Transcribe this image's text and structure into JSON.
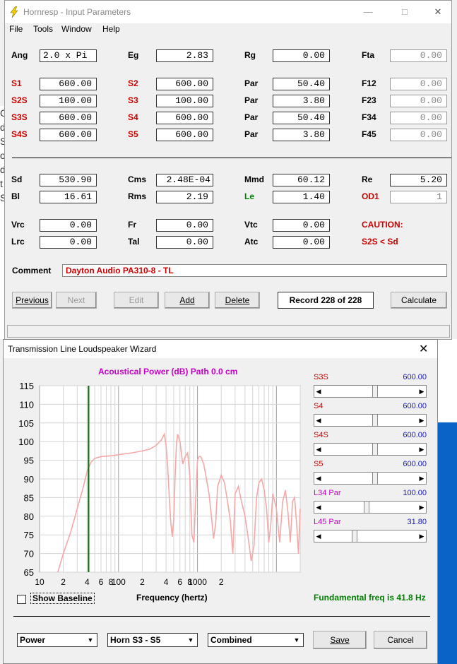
{
  "main_window": {
    "title": "Hornresp - Input Parameters",
    "menu": [
      "File",
      "Tools",
      "Window",
      "Help"
    ],
    "params": {
      "ang": {
        "label": "Ang",
        "value": "2.0 x Pi"
      },
      "eg": {
        "label": "Eg",
        "value": "2.83"
      },
      "rg": {
        "label": "Rg",
        "value": "0.00"
      },
      "fta": {
        "label": "Fta",
        "value": "0.00"
      },
      "s1": {
        "label": "S1",
        "value": "600.00"
      },
      "s2": {
        "label": "S2",
        "value": "600.00"
      },
      "par1": {
        "label": "Par",
        "value": "50.40"
      },
      "f12": {
        "label": "F12",
        "value": "0.00"
      },
      "s2s": {
        "label": "S2S",
        "value": "100.00"
      },
      "s3": {
        "label": "S3",
        "value": "100.00"
      },
      "par2": {
        "label": "Par",
        "value": "3.80"
      },
      "f23": {
        "label": "F23",
        "value": "0.00"
      },
      "s3s": {
        "label": "S3S",
        "value": "600.00"
      },
      "s4": {
        "label": "S4",
        "value": "600.00"
      },
      "par3": {
        "label": "Par",
        "value": "50.40"
      },
      "f34": {
        "label": "F34",
        "value": "0.00"
      },
      "s4s": {
        "label": "S4S",
        "value": "600.00"
      },
      "s5": {
        "label": "S5",
        "value": "600.00"
      },
      "par4": {
        "label": "Par",
        "value": "3.80"
      },
      "f45": {
        "label": "F45",
        "value": "0.00"
      },
      "sd": {
        "label": "Sd",
        "value": "530.90"
      },
      "cms": {
        "label": "Cms",
        "value": "2.48E-04"
      },
      "mmd": {
        "label": "Mmd",
        "value": "60.12"
      },
      "re": {
        "label": "Re",
        "value": "5.20"
      },
      "bl": {
        "label": "Bl",
        "value": "16.61"
      },
      "rms": {
        "label": "Rms",
        "value": "2.19"
      },
      "le": {
        "label": "Le",
        "value": "1.40"
      },
      "od1": {
        "label": "OD1",
        "value": "1"
      },
      "vrc": {
        "label": "Vrc",
        "value": "0.00"
      },
      "fr": {
        "label": "Fr",
        "value": "0.00"
      },
      "vtc": {
        "label": "Vtc",
        "value": "0.00"
      },
      "lrc": {
        "label": "Lrc",
        "value": "0.00"
      },
      "tal": {
        "label": "Tal",
        "value": "0.00"
      },
      "atc": {
        "label": "Atc",
        "value": "0.00"
      }
    },
    "caution": "CAUTION:",
    "caution_detail": "S2S < Sd",
    "comment_label": "Comment",
    "comment_value": "Dayton Audio PA310-8 - TL",
    "buttons": {
      "previous": "Previous",
      "next": "Next",
      "edit": "Edit",
      "add": "Add",
      "delete": "Delete",
      "calculate": "Calculate"
    },
    "record": "Record 228 of 228"
  },
  "wizard": {
    "title": "Transmission Line Loudspeaker Wizard",
    "chart_header": "Acoustical Power (dB)   Path 0.0 cm",
    "sliders": [
      {
        "label": "S3S",
        "value": "600.00",
        "fill": 0.55
      },
      {
        "label": "S4",
        "value": "600.00",
        "fill": 0.55
      },
      {
        "label": "S4S",
        "value": "600.00",
        "fill": 0.55
      },
      {
        "label": "S5",
        "value": "600.00",
        "fill": 0.55
      },
      {
        "label": "L34  Par",
        "value": "100.00",
        "fill": 0.45
      },
      {
        "label": "L45  Par",
        "value": "31.80",
        "fill": 0.32
      }
    ],
    "show_baseline": "Show Baseline",
    "frequency_label": "Frequency (hertz)",
    "fundamental": "Fundamental freq is 41.8 Hz",
    "combos": {
      "mode": "Power",
      "section": "Horn S3 - S5",
      "output": "Combined"
    },
    "buttons": {
      "save": "Save",
      "cancel": "Cancel"
    }
  },
  "chart_data": {
    "type": "line",
    "title": "Acoustical Power (dB)   Path 0.0 cm",
    "xlabel": "Frequency (hertz)",
    "ylabel": "",
    "x_scale": "log",
    "xlim": [
      10,
      20000
    ],
    "ylim": [
      65,
      115
    ],
    "y_ticks": [
      65,
      70,
      75,
      80,
      85,
      90,
      95,
      100,
      105,
      110,
      115
    ],
    "x_tick_labels": [
      "10",
      "2",
      "4",
      "6",
      "8",
      "100",
      "2",
      "4",
      "6",
      "8",
      "1000",
      "2"
    ],
    "grid": true,
    "marker_frequency_hz": 41.8,
    "series": [
      {
        "color": "#f4a8a8",
        "x": [
          17,
          20,
          25,
          30,
          35,
          40,
          45,
          50,
          60,
          80,
          100,
          150,
          200,
          250,
          300,
          350,
          380,
          400,
          420,
          440,
          460,
          480,
          500,
          520,
          540,
          560,
          600,
          650,
          700,
          750,
          800,
          850,
          900,
          950,
          1000,
          1050,
          1100,
          1200,
          1300,
          1400,
          1500,
          1600,
          1700,
          1800,
          2000,
          2200,
          2400,
          2600,
          2800,
          3000,
          3300,
          3600,
          4000,
          4400,
          4800,
          5200,
          5600,
          6000,
          6500,
          7000,
          7500,
          8000,
          8500,
          9000,
          10000,
          11000,
          12000,
          13000,
          14000,
          15000,
          16000,
          17000,
          18000,
          19000,
          20000
        ],
        "y": [
          65,
          70,
          76,
          82,
          87,
          92,
          94.5,
          95.5,
          96,
          96.2,
          96.5,
          97,
          97.5,
          98,
          99,
          100.5,
          102,
          99,
          93,
          85,
          78,
          74.5,
          79,
          90,
          99,
          102,
          100,
          94,
          96,
          97,
          91,
          75,
          73,
          85,
          95,
          96,
          96,
          94,
          90,
          86,
          80,
          74,
          78,
          88,
          91,
          89,
          84,
          79,
          70,
          86,
          88,
          84,
          80,
          74,
          68,
          72,
          85,
          89,
          90,
          87,
          82,
          73,
          78,
          86,
          82,
          73,
          84,
          87,
          81,
          73,
          84,
          85,
          78,
          70,
          82
        ]
      }
    ]
  }
}
